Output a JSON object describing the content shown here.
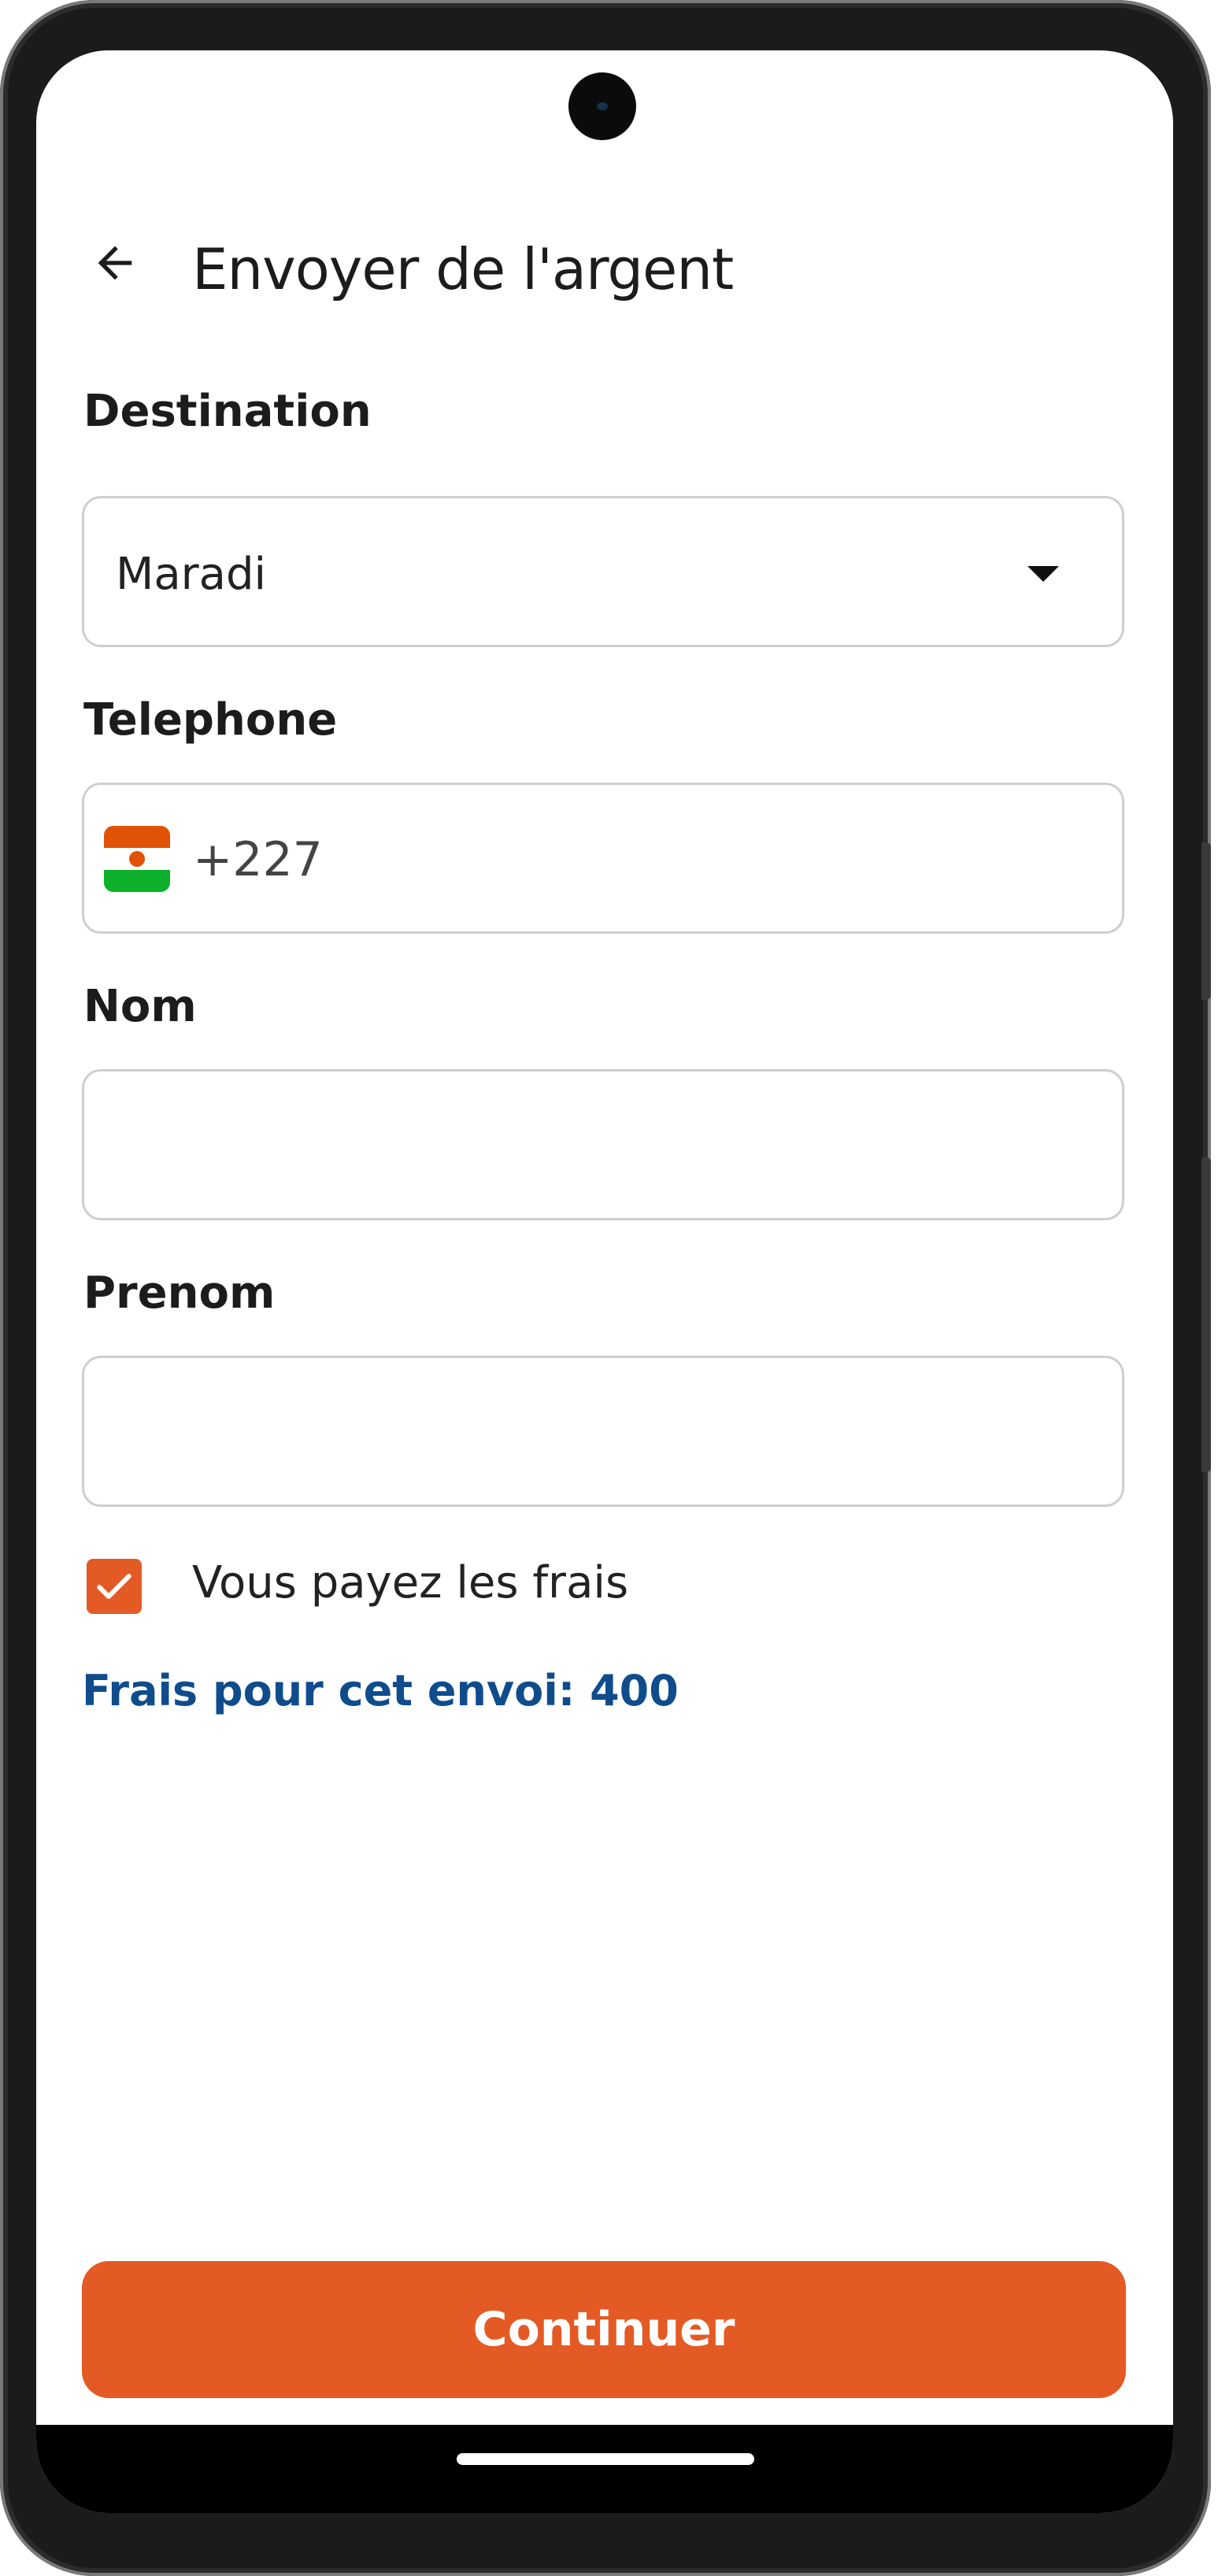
{
  "app_bar": {
    "title": "Envoyer de l'argent",
    "back_icon": "arrow-left-icon"
  },
  "form": {
    "destination": {
      "label": "Destination",
      "selected": "Maradi",
      "icon": "dropdown-arrow-icon"
    },
    "telephone": {
      "label": "Telephone",
      "country_flag": "niger-flag-icon",
      "country_code": "+227",
      "value": ""
    },
    "nom": {
      "label": "Nom",
      "value": ""
    },
    "prenom": {
      "label": "Prenom",
      "value": ""
    },
    "pay_fees": {
      "label": "Vous payez les frais",
      "checked": true
    },
    "fees_text": "Frais pour cet envoi: 400"
  },
  "actions": {
    "continue_label": "Continuer"
  },
  "colors": {
    "accent": "#e45a24",
    "fees_text": "#0f4c8c",
    "text": "#1c1c1c",
    "border": "#cfcfcf"
  }
}
